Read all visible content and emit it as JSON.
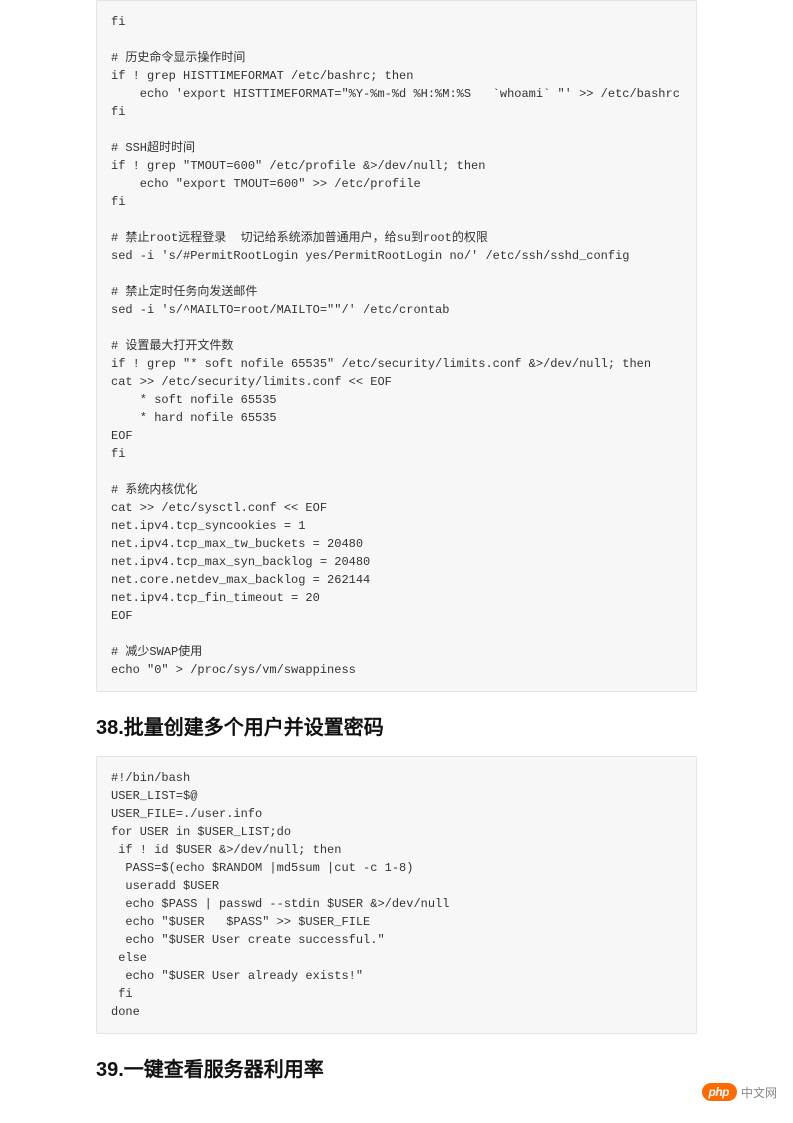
{
  "code1": "fi\n\n# 历史命令显示操作时间\nif ! grep HISTTIMEFORMAT /etc/bashrc; then\n    echo 'export HISTTIMEFORMAT=\"%Y-%m-%d %H:%M:%S   `whoami` \"' >> /etc/bashrc\nfi\n\n# SSH超时时间\nif ! grep \"TMOUT=600\" /etc/profile &>/dev/null; then\n    echo \"export TMOUT=600\" >> /etc/profile\nfi\n\n# 禁止root远程登录  切记给系统添加普通用户，给su到root的权限\nsed -i 's/#PermitRootLogin yes/PermitRootLogin no/' /etc/ssh/sshd_config\n\n# 禁止定时任务向发送邮件\nsed -i 's/^MAILTO=root/MAILTO=\"\"/' /etc/crontab\n\n# 设置最大打开文件数\nif ! grep \"* soft nofile 65535\" /etc/security/limits.conf &>/dev/null; then\ncat >> /etc/security/limits.conf << EOF\n    * soft nofile 65535\n    * hard nofile 65535\nEOF\nfi\n\n# 系统内核优化\ncat >> /etc/sysctl.conf << EOF\nnet.ipv4.tcp_syncookies = 1\nnet.ipv4.tcp_max_tw_buckets = 20480\nnet.ipv4.tcp_max_syn_backlog = 20480\nnet.core.netdev_max_backlog = 262144\nnet.ipv4.tcp_fin_timeout = 20\nEOF\n\n# 减少SWAP使用\necho \"0\" > /proc/sys/vm/swappiness",
  "heading38": "38.批量创建多个用户并设置密码",
  "code2": "#!/bin/bash\nUSER_LIST=$@\nUSER_FILE=./user.info\nfor USER in $USER_LIST;do\n if ! id $USER &>/dev/null; then\n  PASS=$(echo $RANDOM |md5sum |cut -c 1-8)\n  useradd $USER\n  echo $PASS | passwd --stdin $USER &>/dev/null\n  echo \"$USER   $PASS\" >> $USER_FILE\n  echo \"$USER User create successful.\"\n else\n  echo \"$USER User already exists!\"\n fi\ndone",
  "heading39": "39.一键查看服务器利用率",
  "watermark": {
    "badge": "php",
    "text": "中文网"
  }
}
